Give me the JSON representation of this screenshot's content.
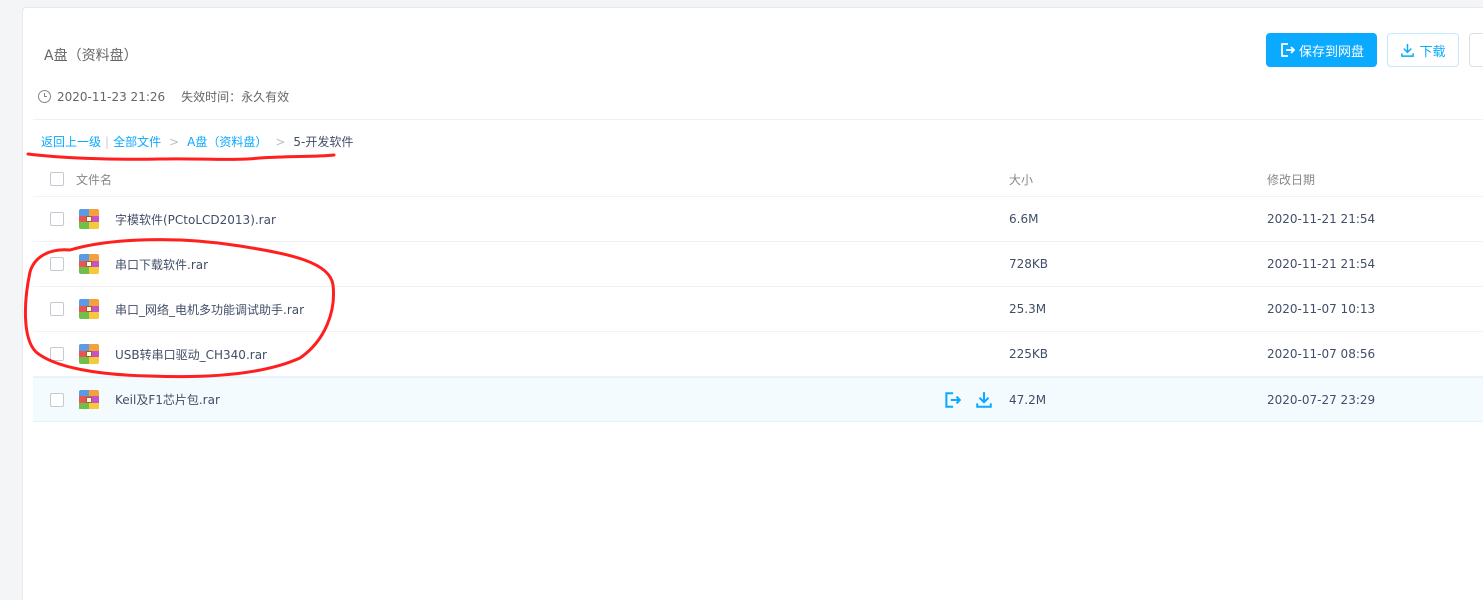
{
  "share": {
    "title": "A盘（资料盘）",
    "date": "2020-11-23 21:26",
    "expire": "失效时间：永久有效"
  },
  "toolbar": {
    "save_label": "保存到网盘",
    "download_label": "下载"
  },
  "breadcrumb": {
    "back": "返回上一级",
    "all_files": "全部文件",
    "folder": "A盘（资料盘）",
    "current": "5-开发软件"
  },
  "table": {
    "headers": {
      "name": "文件名",
      "size": "大小",
      "date": "修改日期"
    },
    "rows": [
      {
        "name": "字模软件(PCtoLCD2013).rar",
        "size": "6.6M",
        "date": "2020-11-21 21:54"
      },
      {
        "name": "串口下载软件.rar",
        "size": "728KB",
        "date": "2020-11-21 21:54"
      },
      {
        "name": "串口_网络_电机多功能调试助手.rar",
        "size": "25.3M",
        "date": "2020-11-07 10:13"
      },
      {
        "name": "USB转串口驱动_CH340.rar",
        "size": "225KB",
        "date": "2020-11-07 08:56"
      },
      {
        "name": "Keil及F1芯片包.rar",
        "size": "47.2M",
        "date": "2020-07-27 23:29"
      }
    ]
  },
  "icons": {
    "save": "save-to-cloud-icon",
    "download": "download-icon",
    "clock": "clock-icon",
    "file": "rar-archive-icon"
  },
  "colors": {
    "accent": "#09aaff",
    "annotation": "#ff1f1f"
  }
}
